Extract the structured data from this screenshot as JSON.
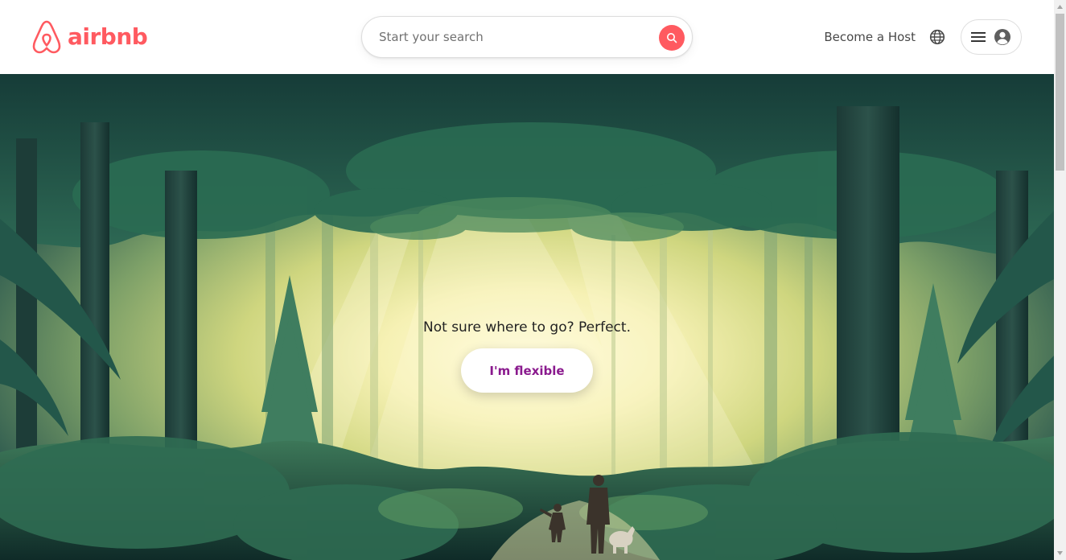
{
  "brand": {
    "name": "airbnb",
    "color": "#ff5a60"
  },
  "header": {
    "search": {
      "placeholder": "Start your search",
      "icon": "search-icon"
    },
    "become_host": "Become a Host",
    "language_icon": "globe-icon",
    "menu_icon": "hamburger-icon",
    "account_icon": "user-icon"
  },
  "hero": {
    "tagline": "Not sure where to go? Perfect.",
    "cta_label": "I'm flexible",
    "cta_color": "#8a1a8e",
    "image": "forest-illustration"
  },
  "colors": {
    "text": "#222222",
    "muted": "#717171",
    "border": "#dddddd"
  }
}
